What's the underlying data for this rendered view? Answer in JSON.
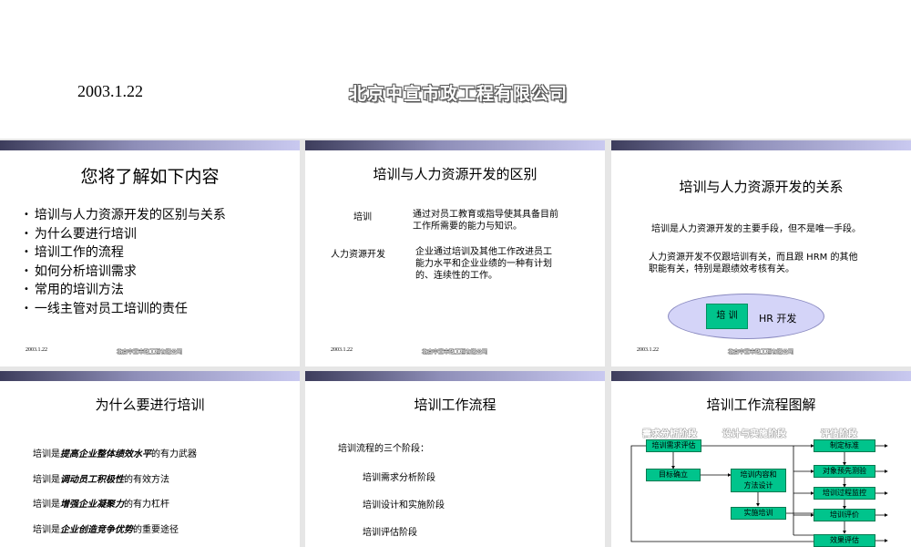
{
  "header": {
    "date": "2003.1.22",
    "company": "北京中宣市政工程有限公司"
  },
  "slides": {
    "s1": {
      "title": "您将了解如下内容",
      "bullets": [
        "培训与人力资源开发的区别与关系",
        "为什么要进行培训",
        "培训工作的流程",
        "如何分析培训需求",
        "常用的培训方法",
        "一线主管对员工培训的责任"
      ],
      "footer_date": "2003.1.22",
      "footer_company": "北京中宣市政工程有限公司"
    },
    "s2": {
      "title": "培训与人力资源开发的区别",
      "term1": "培训",
      "desc1": [
        "通过对员工教育或指导使其具备目前",
        "工作所需要的能力与知识。"
      ],
      "term2": "人力资源开发",
      "desc2": [
        "企业通过培训及其他工作改进员工",
        "能力水平和企业业绩的一种有计划",
        "的、连续性的工作。"
      ],
      "footer_date": "2003.1.22",
      "footer_company": "北京中宣市政工程有限公司"
    },
    "s3": {
      "title": "培训与人力资源开发的关系",
      "para1": "培训是人力资源开发的主要手段，但不是唯一手段。",
      "para2": [
        "人力资源开发不仅跟培训有关，而且跟 HRM 的其他",
        "职能有关，特别是跟绩效考核有关。"
      ],
      "inner_label": "培 训",
      "outer_label": "HR 开发",
      "footer_date": "2003.1.22",
      "footer_company": "北京中宣市政工程有限公司"
    },
    "s4": {
      "title": "为什么要进行培训",
      "lines": [
        {
          "pre": "培训是",
          "em": "提高企业整体绩效水平",
          "post": "的有力武器"
        },
        {
          "pre": "培训是",
          "em": "调动员工积极性",
          "post": "的有效方法"
        },
        {
          "pre": "培训是",
          "em": "增强企业凝聚力",
          "post": "的有力杠杆"
        },
        {
          "pre": "培训是",
          "em": "企业创造竞争优势",
          "post": "的重要途径"
        }
      ]
    },
    "s5": {
      "title": "培训工作流程",
      "intro": "培训流程的三个阶段：",
      "stages": [
        "培训需求分析阶段",
        "培训设计和实施阶段",
        "培训评估阶段"
      ]
    },
    "s6": {
      "title": "培训工作流程图解",
      "phases": [
        "需求分析阶段",
        "设计与实施阶段",
        "评估阶段"
      ],
      "boxes": {
        "needs": "培训需求评估",
        "goal": "目标确立",
        "content": [
          "培训内容和",
          "方法设计"
        ],
        "implement": "实施培训",
        "standard": "制定标准",
        "pretest": "对象预先测验",
        "monitor": "培训过程监控",
        "evaluate": "培训评价",
        "results": "效果评估"
      }
    }
  }
}
